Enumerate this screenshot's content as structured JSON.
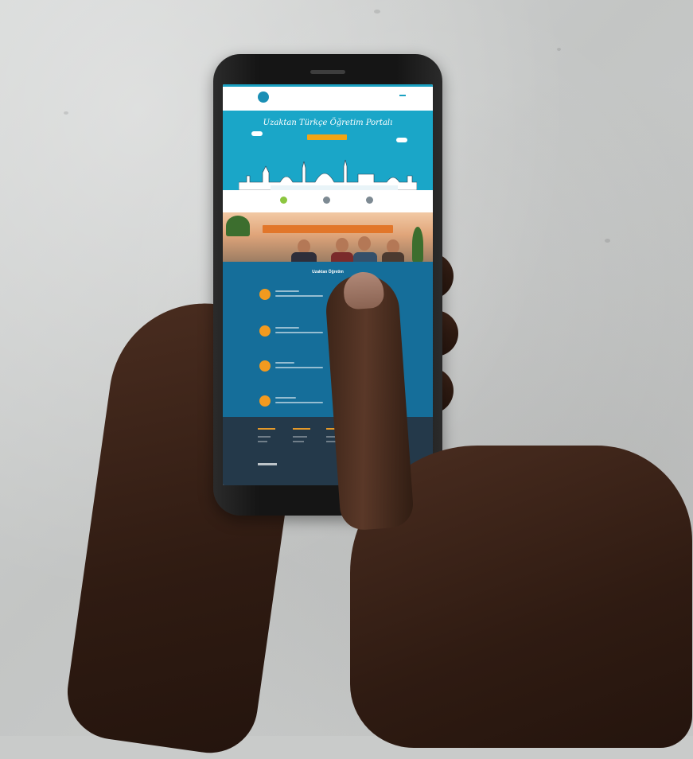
{
  "scene": {
    "subject": "hands-holding-smartphone",
    "background_color": "#c9cbca",
    "skin_color": "#3a2318"
  },
  "phone_screen": {
    "header": {
      "logo_text": "",
      "nav_items": [
        "",
        "",
        ""
      ],
      "nav_button": ""
    },
    "hero": {
      "title": "Uzaktan Türkçe Öğretim Portalı",
      "background_color": "#1aa6c8",
      "cta_color": "#f2a515"
    },
    "feature_icons": [
      "green-circle-icon",
      "gray-circle-icon",
      "gray-circle-icon"
    ],
    "photo_banner_color": "#e2762a",
    "services": {
      "title": "Uzaktan Öğretim",
      "background_color": "#156e9a",
      "item_count": 4
    },
    "footer": {
      "background_color": "#24394a"
    }
  }
}
